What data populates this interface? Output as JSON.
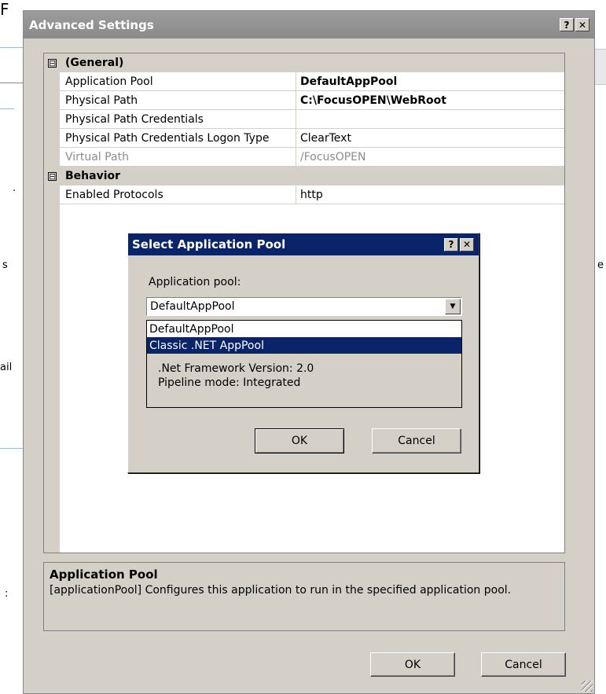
{
  "background": {
    "title_fragment": "F",
    "left_fragments": [
      "s",
      "ail",
      ":"
    ],
    "right_fragment": "e"
  },
  "window": {
    "title": "Advanced Settings",
    "help_button": "?",
    "close_button": "✕"
  },
  "grid": {
    "categories": [
      {
        "label": "(General)",
        "expander": "⊟",
        "rows": [
          {
            "name": "Application Pool",
            "value": "DefaultAppPool"
          },
          {
            "name": "Physical Path",
            "value": "C:\\FocusOPEN\\WebRoot"
          },
          {
            "name": "Physical Path Credentials",
            "value": ""
          },
          {
            "name": "Physical Path Credentials Logon Type",
            "value": "ClearText"
          },
          {
            "name": "Virtual Path",
            "value": "/FocusOPEN"
          }
        ]
      },
      {
        "label": "Behavior",
        "expander": "⊟",
        "rows": [
          {
            "name": "Enabled Protocols",
            "value": "http"
          }
        ]
      }
    ]
  },
  "description": {
    "title": "Application Pool",
    "text": "[applicationPool] Configures this application to run in the specified application pool."
  },
  "buttons": {
    "ok": "OK",
    "cancel": "Cancel"
  },
  "dialog": {
    "title": "Select Application Pool",
    "help_button": "?",
    "close_button": "✕",
    "label": "Application pool:",
    "selected_value": "DefaultAppPool",
    "options": [
      "DefaultAppPool",
      "Classic .NET AppPool"
    ],
    "highlighted_option": 1,
    "info_line1": ".Net Framework Version: 2.0",
    "info_line2": "Pipeline mode: Integrated",
    "ok": "OK",
    "cancel": "Cancel"
  }
}
